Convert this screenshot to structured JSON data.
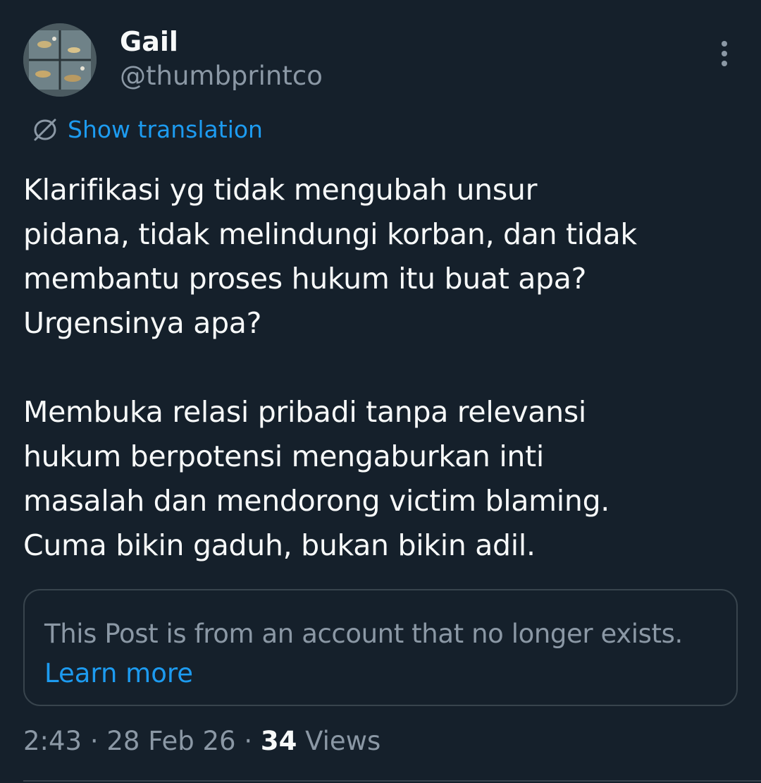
{
  "author": {
    "display_name": "Gail",
    "handle": "@thumbprintco"
  },
  "translation": {
    "label": "Show translation"
  },
  "tweet": {
    "lines": [
      "Klarifikasi yg tidak mengubah unsur",
      "pidana, tidak melindungi korban, dan tidak",
      "membantu proses hukum itu buat apa?",
      "Urgensinya apa?",
      "Membuka relasi pribadi tanpa relevansi",
      "hukum berpotensi mengaburkan inti",
      "masalah dan mendorong victim blaming.",
      "Cuma bikin gaduh, bukan bikin adil."
    ]
  },
  "quoted_notice": {
    "message": "This Post is from an account that no longer exists.",
    "link": "Learn more"
  },
  "meta": {
    "time": "2:43",
    "separator": "·",
    "date": "28 Feb 26",
    "views_count": "34",
    "views_label": "Views"
  },
  "icons": {
    "more": "more-vertical-icon",
    "translate": "globe-icon"
  },
  "colors": {
    "background": "#15202b",
    "accent": "#1d9bf0",
    "text_primary": "#f7f9f9",
    "text_secondary": "#8b98a5",
    "border": "#38444d"
  }
}
